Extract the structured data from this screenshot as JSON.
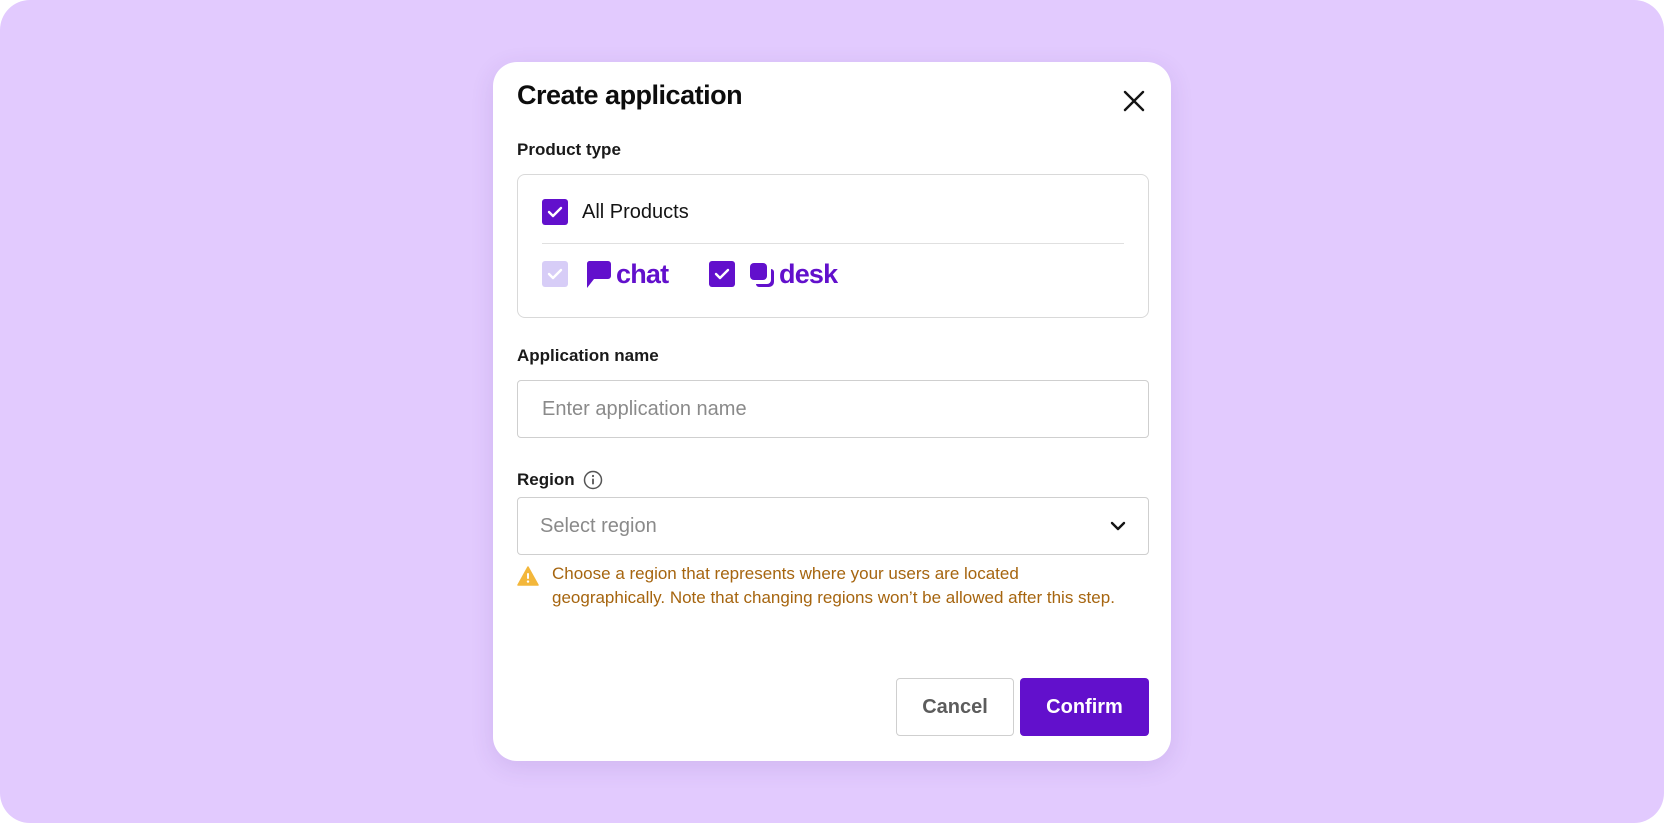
{
  "modal": {
    "title": "Create application",
    "close_icon": "close-icon"
  },
  "product_type": {
    "label": "Product type",
    "all_products": {
      "label": "All Products",
      "checked": true
    },
    "products": [
      {
        "name": "chat",
        "checked": true,
        "disabled": true,
        "icon": "chat-logo-icon"
      },
      {
        "name": "desk",
        "checked": true,
        "disabled": false,
        "icon": "desk-logo-icon"
      }
    ]
  },
  "application_name": {
    "label": "Application name",
    "value": "",
    "placeholder": "Enter application name"
  },
  "region": {
    "label": "Region",
    "info_icon": "info-icon",
    "placeholder": "Select region",
    "warning_icon": "warning-triangle-icon",
    "warning": "Choose a region that represents where your users are located geographically. Note that changing regions won’t be allowed after this step."
  },
  "actions": {
    "cancel_label": "Cancel",
    "confirm_label": "Confirm"
  },
  "colors": {
    "backdrop": "#e2cafe",
    "accent": "#6210cc",
    "accent_disabled": "#d7cdf7",
    "warning_text": "#a6650f",
    "warning_icon": "#f3b73b"
  }
}
